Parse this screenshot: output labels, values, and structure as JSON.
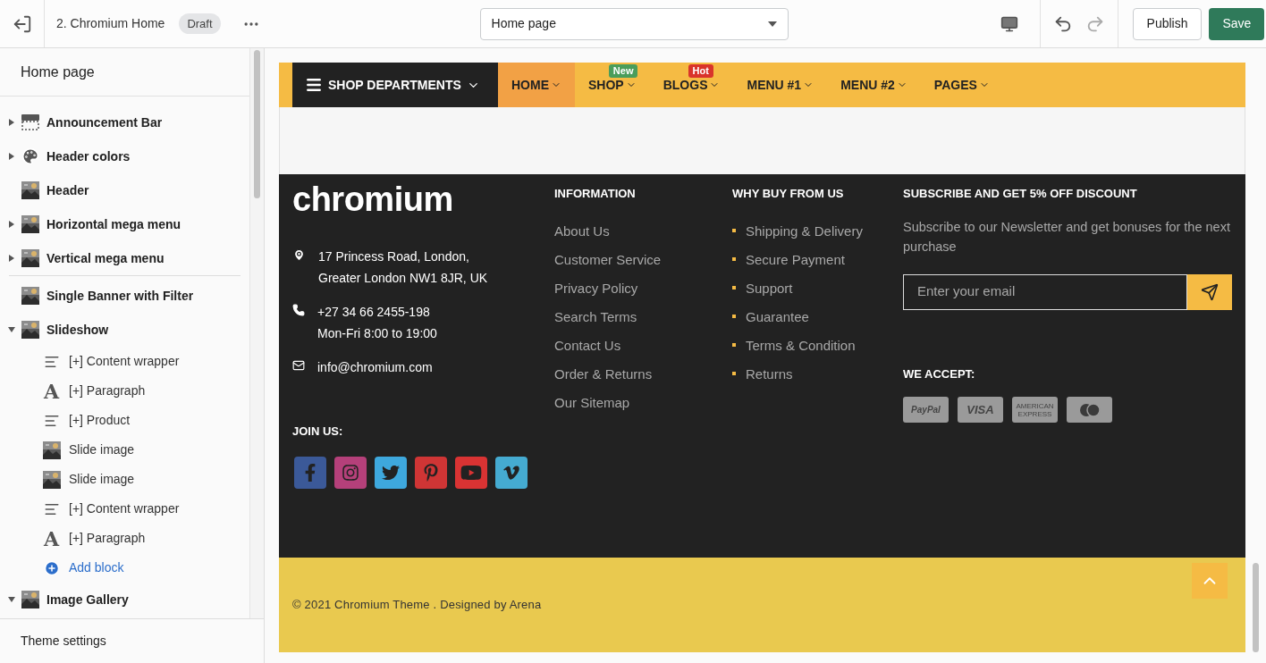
{
  "topbar": {
    "theme_name": "2. Chromium Home",
    "status_badge": "Draft",
    "page_select": {
      "value": "Home page"
    },
    "publish": "Publish",
    "save": "Save"
  },
  "sidebar": {
    "title": "Home page",
    "groups": [
      [
        {
          "label": "Announcement Bar",
          "kind": "announcement",
          "expanded": false
        },
        {
          "label": "Header colors",
          "kind": "palette",
          "expanded": false
        },
        {
          "label": "Header",
          "kind": "picture"
        },
        {
          "label": "Horizontal mega menu",
          "kind": "picture",
          "expanded": false
        },
        {
          "label": "Vertical mega menu",
          "kind": "picture",
          "expanded": false
        }
      ],
      [
        {
          "label": "Single Banner with Filter",
          "kind": "picture"
        },
        {
          "label": "Slideshow",
          "kind": "picture",
          "expanded": true,
          "children": [
            {
              "label": "[+] Content wrapper",
              "kind": "text"
            },
            {
              "label": "[+] Paragraph",
              "kind": "font",
              "icon_text": "A"
            },
            {
              "label": "[+] Product",
              "kind": "text"
            },
            {
              "label": "Slide image",
              "kind": "picture"
            },
            {
              "label": "Slide image",
              "kind": "picture"
            },
            {
              "label": "[+] Content wrapper",
              "kind": "text"
            },
            {
              "label": "[+] Paragraph",
              "kind": "font",
              "icon_text": "A"
            },
            {
              "label": "Add block",
              "kind": "add"
            }
          ]
        },
        {
          "label": "Image Gallery",
          "kind": "picture",
          "expanded": true
        }
      ]
    ],
    "footer": "Theme settings"
  },
  "store": {
    "nav": {
      "departments": "SHOP DEPARTMENTS",
      "items": [
        {
          "label": "HOME",
          "selected": true
        },
        {
          "label": "SHOP",
          "selected": false,
          "badge": {
            "text": "New",
            "color": "#4a9d5b"
          }
        },
        {
          "label": "BLOGS",
          "selected": false,
          "badge": {
            "text": "Hot",
            "color": "#d9342b"
          }
        },
        {
          "label": "MENU #1",
          "selected": false
        },
        {
          "label": "MENU #2",
          "selected": false
        },
        {
          "label": "PAGES",
          "selected": false
        }
      ]
    },
    "footer": {
      "logo": "chromium",
      "contacts": [
        {
          "kind": "location",
          "lines": [
            "17 Princess Road, London,",
            "Greater London NW1 8JR, UK"
          ]
        },
        {
          "kind": "phone",
          "lines": [
            "+27 34 66 2455-198",
            "Mon-Fri 8:00 to 19:00"
          ]
        },
        {
          "kind": "mail",
          "lines": [
            "info@chromium.com"
          ]
        }
      ],
      "join_label": "JOIN US:",
      "socials": [
        {
          "kind": "facebook",
          "color": "#3b5998"
        },
        {
          "kind": "instagram",
          "color": "#b5407a"
        },
        {
          "kind": "twitter",
          "color": "#3ea8dd"
        },
        {
          "kind": "pinterest",
          "color": "#cf3535"
        },
        {
          "kind": "youtube",
          "color": "#d93333"
        },
        {
          "kind": "vimeo",
          "color": "#45abd1"
        }
      ],
      "information": {
        "heading": "INFORMATION",
        "links": [
          "About Us",
          "Customer Service",
          "Privacy Policy",
          "Search Terms",
          "Contact Us",
          "Order & Returns",
          "Our Sitemap"
        ]
      },
      "why_buy": {
        "heading": "WHY BUY FROM US",
        "links": [
          "Shipping & Delivery",
          "Secure Payment",
          "Support",
          "Guarantee",
          "Terms & Condition",
          "Returns"
        ]
      },
      "subscribe": {
        "heading": "SUBSCRIBE AND GET 5% OFF DISCOUNT",
        "text": "Subscribe to our Newsletter and get bonuses for the next purchase",
        "email": {
          "placeholder": "Enter your email"
        }
      },
      "accept": {
        "heading": "WE ACCEPT:",
        "cards": [
          {
            "kind": "paypal",
            "label": "PayPal"
          },
          {
            "kind": "visa",
            "label": "VISA"
          },
          {
            "kind": "amex",
            "label": "AMERICAN EXPRESS"
          },
          {
            "kind": "mastercard"
          }
        ]
      }
    },
    "copyright": "© 2021 Chromium Theme . Designed by Arena"
  }
}
